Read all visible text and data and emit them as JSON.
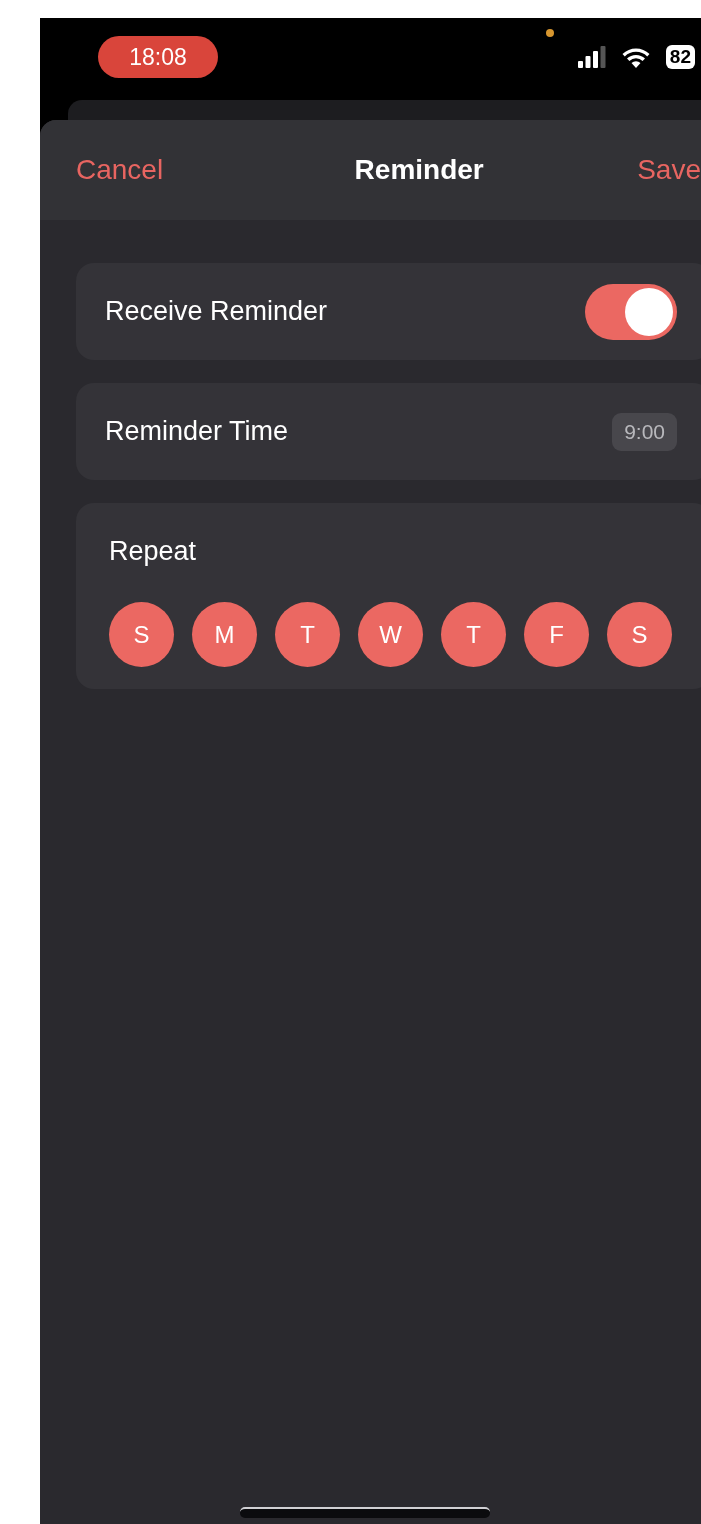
{
  "status_bar": {
    "time": "18:08",
    "battery": "82"
  },
  "header": {
    "cancel": "Cancel",
    "title": "Reminder",
    "save": "Save"
  },
  "receive_reminder": {
    "label": "Receive Reminder",
    "on": true
  },
  "reminder_time": {
    "label": "Reminder Time",
    "value": "9:00"
  },
  "repeat": {
    "label": "Repeat",
    "days": [
      {
        "label": "S",
        "selected": true
      },
      {
        "label": "M",
        "selected": true
      },
      {
        "label": "T",
        "selected": true
      },
      {
        "label": "W",
        "selected": true
      },
      {
        "label": "T",
        "selected": true
      },
      {
        "label": "F",
        "selected": true
      },
      {
        "label": "S",
        "selected": true
      }
    ]
  }
}
